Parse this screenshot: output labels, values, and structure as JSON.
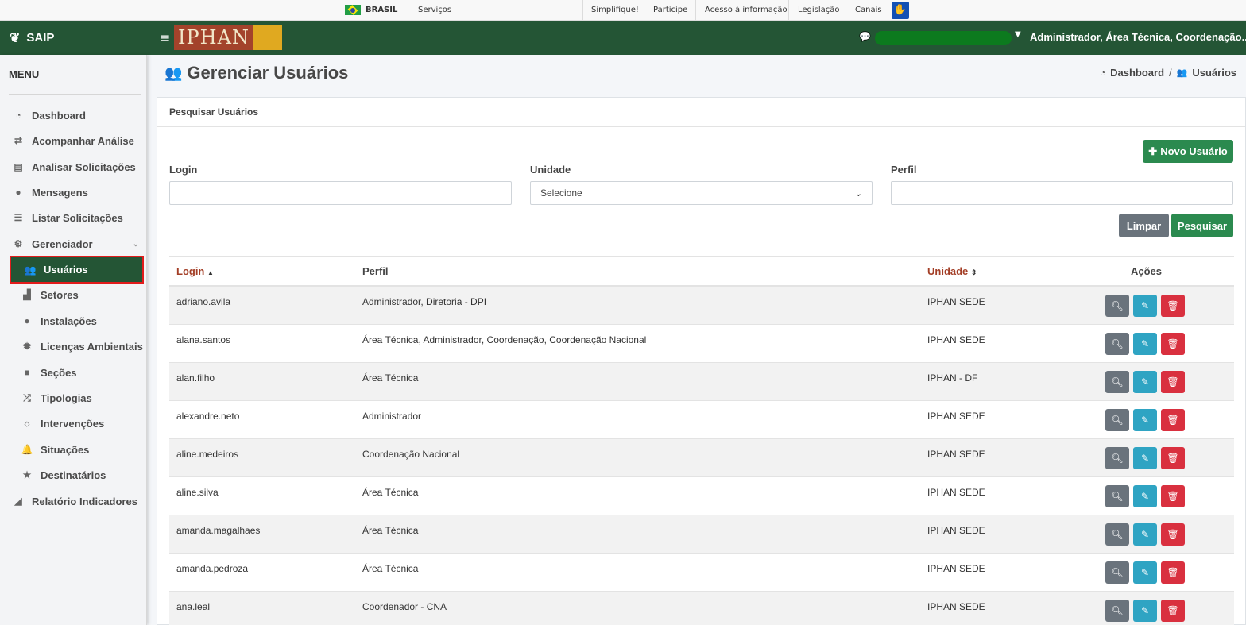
{
  "gov_bar": {
    "country": "BRASIL",
    "services": "Serviços",
    "links": [
      "Simplifique!",
      "Participe",
      "Acesso à informação",
      "Legislação",
      "Canais"
    ]
  },
  "app": {
    "name": "SAIP",
    "logo_text": "IPHAN"
  },
  "header": {
    "user_label": "Administrador, Área Técnica, Coordenação..."
  },
  "sidebar": {
    "menu_title": "MENU",
    "items": [
      {
        "label": "Dashboard",
        "icon": "dashboard-icon"
      },
      {
        "label": "Acompanhar Análise",
        "icon": "exchange-icon"
      },
      {
        "label": "Analisar Solicitações",
        "icon": "book-icon"
      },
      {
        "label": "Mensagens",
        "icon": "comments-icon"
      },
      {
        "label": "Listar Solicitações",
        "icon": "list-icon"
      },
      {
        "label": "Gerenciador",
        "icon": "cogs-icon"
      },
      {
        "label": "Usuários",
        "icon": "users-icon"
      },
      {
        "label": "Setores",
        "icon": "industry-icon"
      },
      {
        "label": "Instalações",
        "icon": "circle-icon"
      },
      {
        "label": "Licenças Ambientais",
        "icon": "certificate-icon"
      },
      {
        "label": "Seções",
        "icon": "square-icon"
      },
      {
        "label": "Tipologias",
        "icon": "random-icon"
      },
      {
        "label": "Intervenções",
        "icon": "sun-icon"
      },
      {
        "label": "Situações",
        "icon": "bell-icon"
      },
      {
        "label": "Destinatários",
        "icon": "star-icon"
      },
      {
        "label": "Relatório Indicadores",
        "icon": "area-chart-icon"
      }
    ]
  },
  "page": {
    "title": "Gerenciar Usuários",
    "breadcrumb": [
      "Dashboard",
      "Usuários"
    ]
  },
  "search": {
    "card_title": "Pesquisar Usuários",
    "new_user_label": "Novo Usuário",
    "login_label": "Login",
    "login_value": "",
    "unidade_label": "Unidade",
    "unidade_selected": "Selecione",
    "perfil_label": "Perfil",
    "perfil_value": "",
    "clear_label": "Limpar",
    "search_label": "Pesquisar"
  },
  "table": {
    "columns": [
      "Login",
      "Perfil",
      "Unidade",
      "Ações"
    ],
    "rows": [
      {
        "login": "adriano.avila",
        "perfil": "Administrador, Diretoria - DPI",
        "unidade": "IPHAN SEDE"
      },
      {
        "login": "alana.santos",
        "perfil": "Área Técnica, Administrador, Coordenação, Coordenação Nacional",
        "unidade": "IPHAN SEDE"
      },
      {
        "login": "alan.filho",
        "perfil": "Área Técnica",
        "unidade": "IPHAN - DF"
      },
      {
        "login": "alexandre.neto",
        "perfil": "Administrador",
        "unidade": "IPHAN SEDE"
      },
      {
        "login": "aline.medeiros",
        "perfil": "Coordenação Nacional",
        "unidade": "IPHAN SEDE"
      },
      {
        "login": "aline.silva",
        "perfil": "Área Técnica",
        "unidade": "IPHAN SEDE"
      },
      {
        "login": "amanda.magalhaes",
        "perfil": "Área Técnica",
        "unidade": "IPHAN SEDE"
      },
      {
        "login": "amanda.pedroza",
        "perfil": "Área Técnica",
        "unidade": "IPHAN SEDE"
      },
      {
        "login": "ana.leal",
        "perfil": "Coordenador - CNA",
        "unidade": "IPHAN SEDE"
      }
    ]
  },
  "colors": {
    "primary_green": "#245535",
    "button_green": "#2b8a4f",
    "sort_header": "#a33e26",
    "view_button": "#6a737c",
    "edit_button": "#2fa4c3",
    "delete_button": "#d9303f",
    "active_outline": "#e21c1c"
  }
}
